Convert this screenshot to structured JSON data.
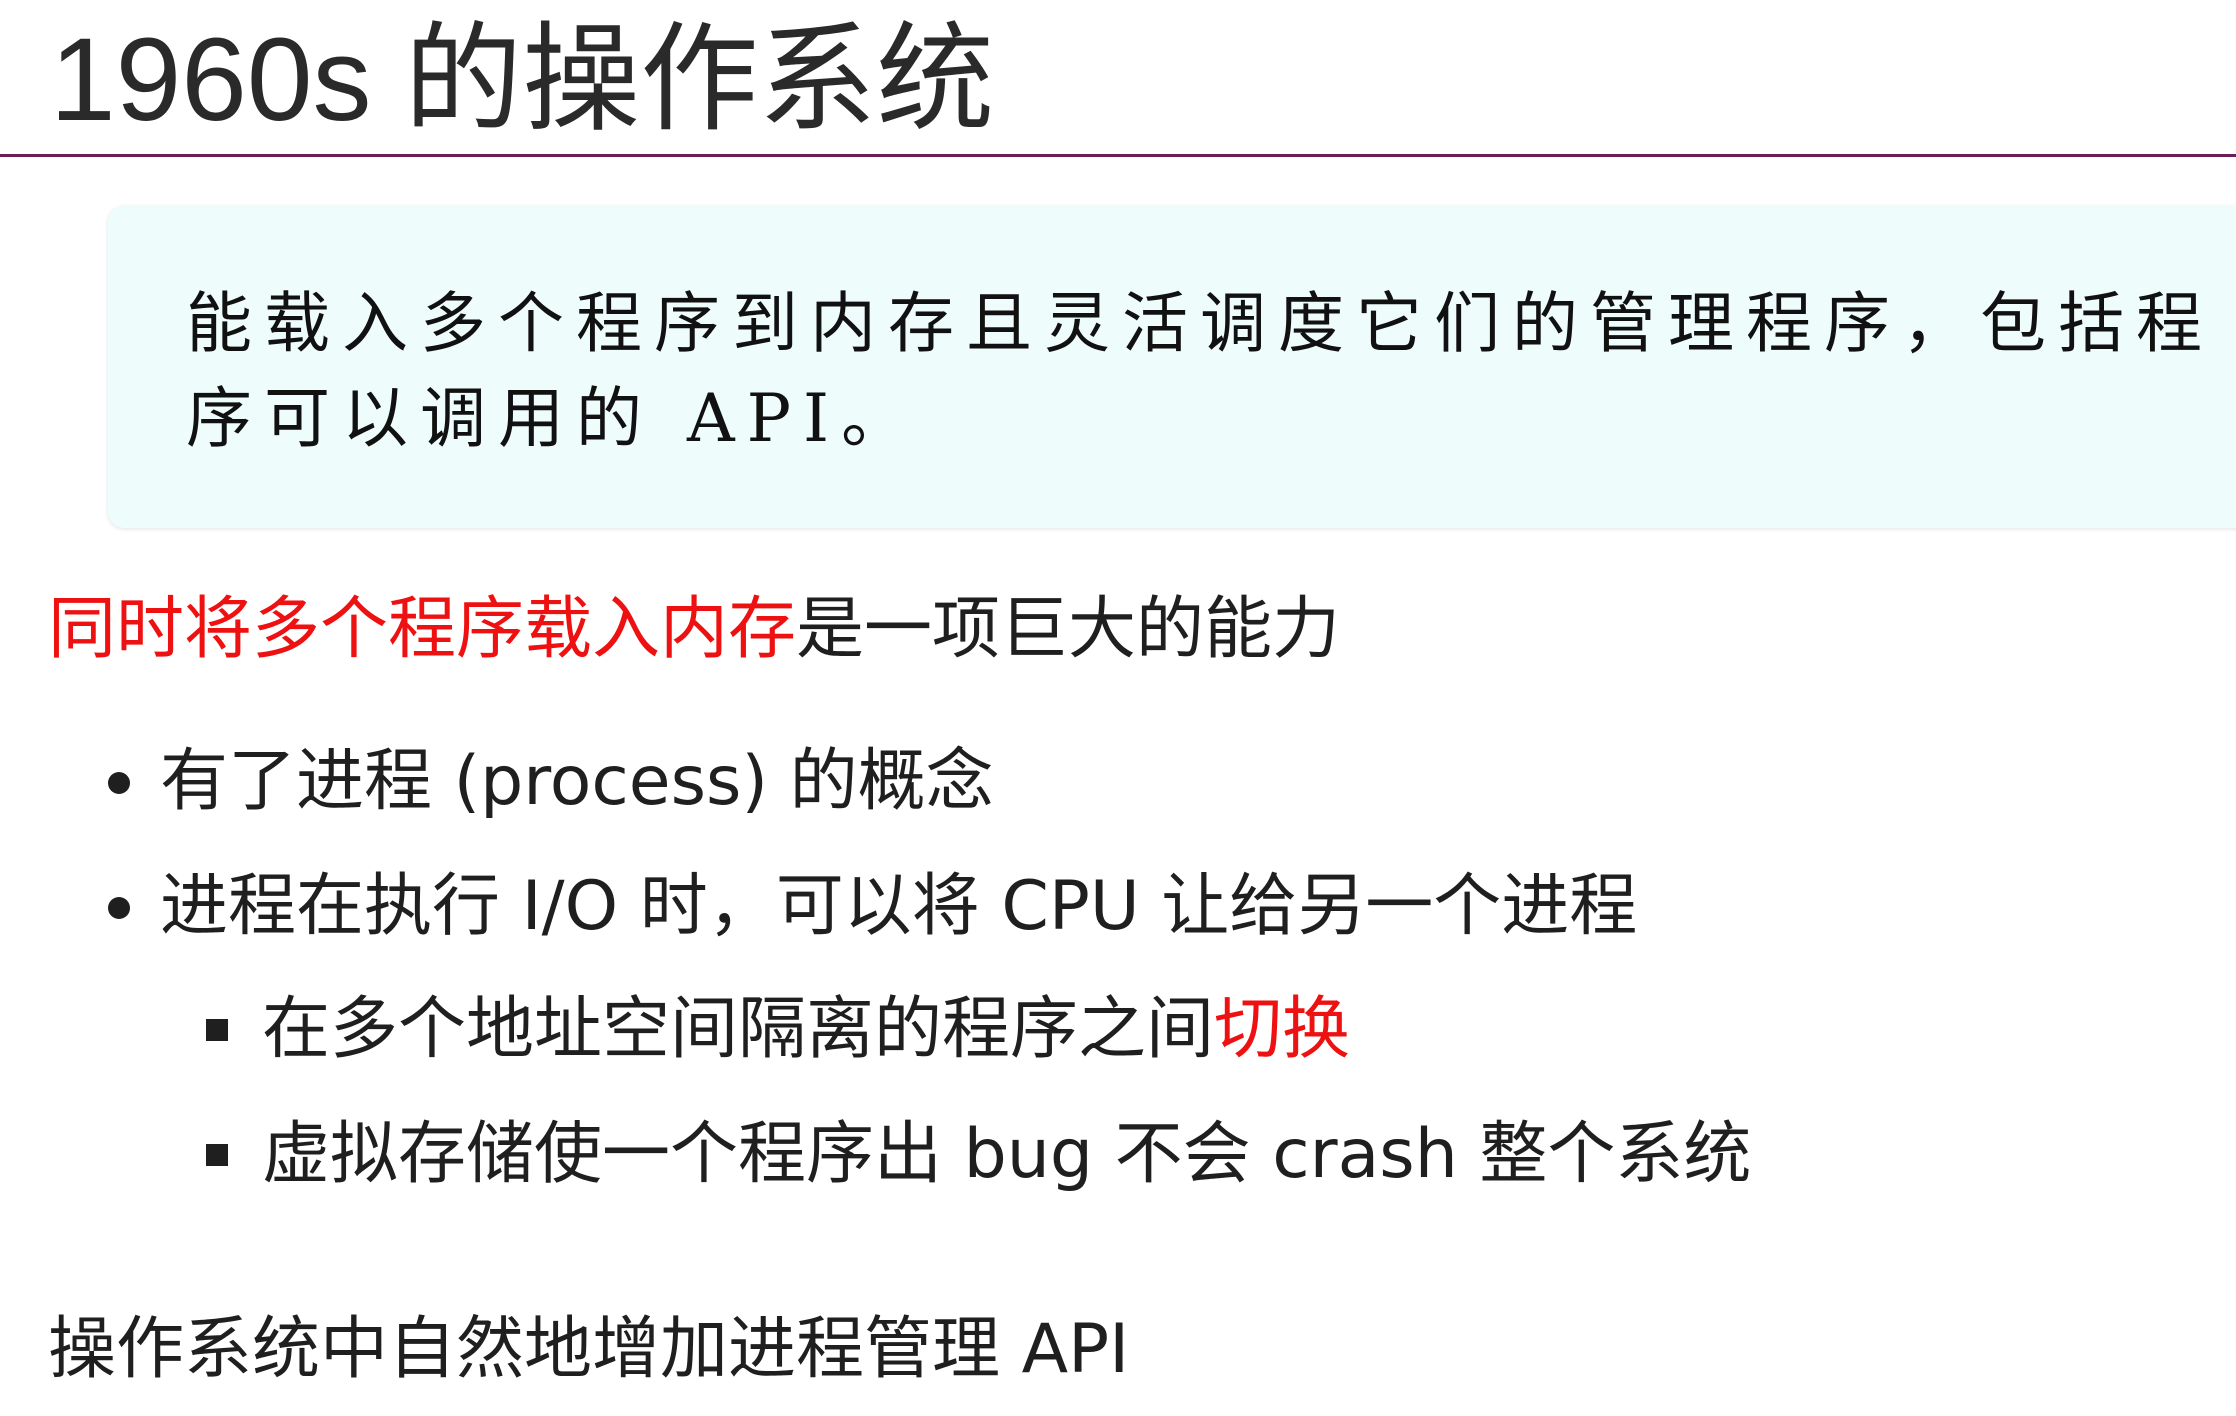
{
  "title": "1960s 的操作系统",
  "definition": {
    "line1": "能载入多个程序到内存且灵活调度它们的管理程序，包括程",
    "line2": "序可以调用的 API。"
  },
  "statement": {
    "highlight": "同时将多个程序载入内存",
    "rest": "是一项巨大的能力"
  },
  "bullets": [
    {
      "text": "有了进程 (process) 的概念"
    },
    {
      "text": "进程在执行 I/O 时，可以将 CPU 让给另一个进程"
    }
  ],
  "sub_bullets": [
    {
      "text": "在多个地址空间隔离的程序之间",
      "highlight": "切换"
    },
    {
      "text": "虚拟存储使一个程序出 bug 不会 crash 整个系统"
    }
  ],
  "footer_line": "操作系统中自然地增加进程管理 API"
}
